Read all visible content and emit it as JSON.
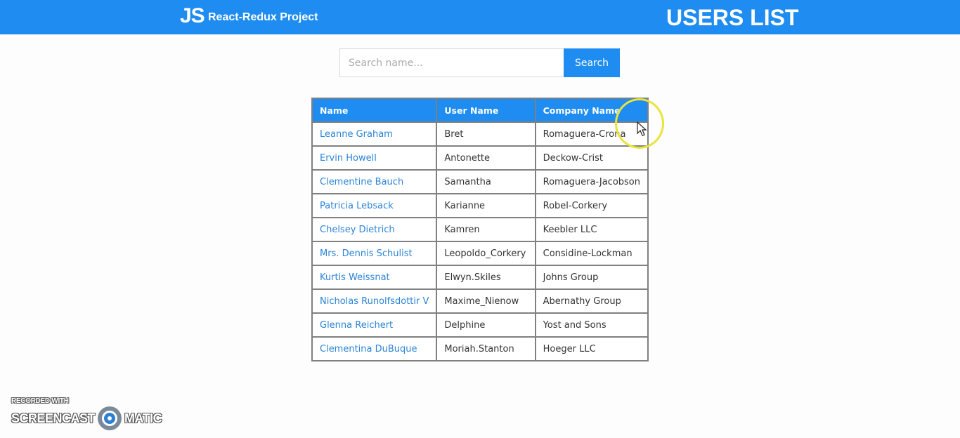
{
  "header": {
    "logo_text": "JS",
    "project_title": "React-Redux Project",
    "page_heading": "USERS LIST",
    "accent_color": "#1e8cf0"
  },
  "search": {
    "placeholder": "Search name...",
    "value": "",
    "button_label": "Search"
  },
  "table": {
    "columns": [
      "Name",
      "User Name",
      "Company Name"
    ],
    "rows": [
      {
        "name": "Leanne Graham",
        "username": "Bret",
        "company": "Romaguera-Crona"
      },
      {
        "name": "Ervin Howell",
        "username": "Antonette",
        "company": "Deckow-Crist"
      },
      {
        "name": "Clementine Bauch",
        "username": "Samantha",
        "company": "Romaguera-Jacobson"
      },
      {
        "name": "Patricia Lebsack",
        "username": "Karianne",
        "company": "Robel-Corkery"
      },
      {
        "name": "Chelsey Dietrich",
        "username": "Kamren",
        "company": "Keebler LLC"
      },
      {
        "name": "Mrs. Dennis Schulist",
        "username": "Leopoldo_Corkery",
        "company": "Considine-Lockman"
      },
      {
        "name": "Kurtis Weissnat",
        "username": "Elwyn.Skiles",
        "company": "Johns Group"
      },
      {
        "name": "Nicholas Runolfsdottir V",
        "username": "Maxime_Nienow",
        "company": "Abernathy Group"
      },
      {
        "name": "Glenna Reichert",
        "username": "Delphine",
        "company": "Yost and Sons"
      },
      {
        "name": "Clementina DuBuque",
        "username": "Moriah.Stanton",
        "company": "Hoeger LLC"
      }
    ]
  },
  "watermark": {
    "line1": "RECORDED WITH",
    "left_word": "SCREENCAST",
    "right_word": "MATIC"
  }
}
